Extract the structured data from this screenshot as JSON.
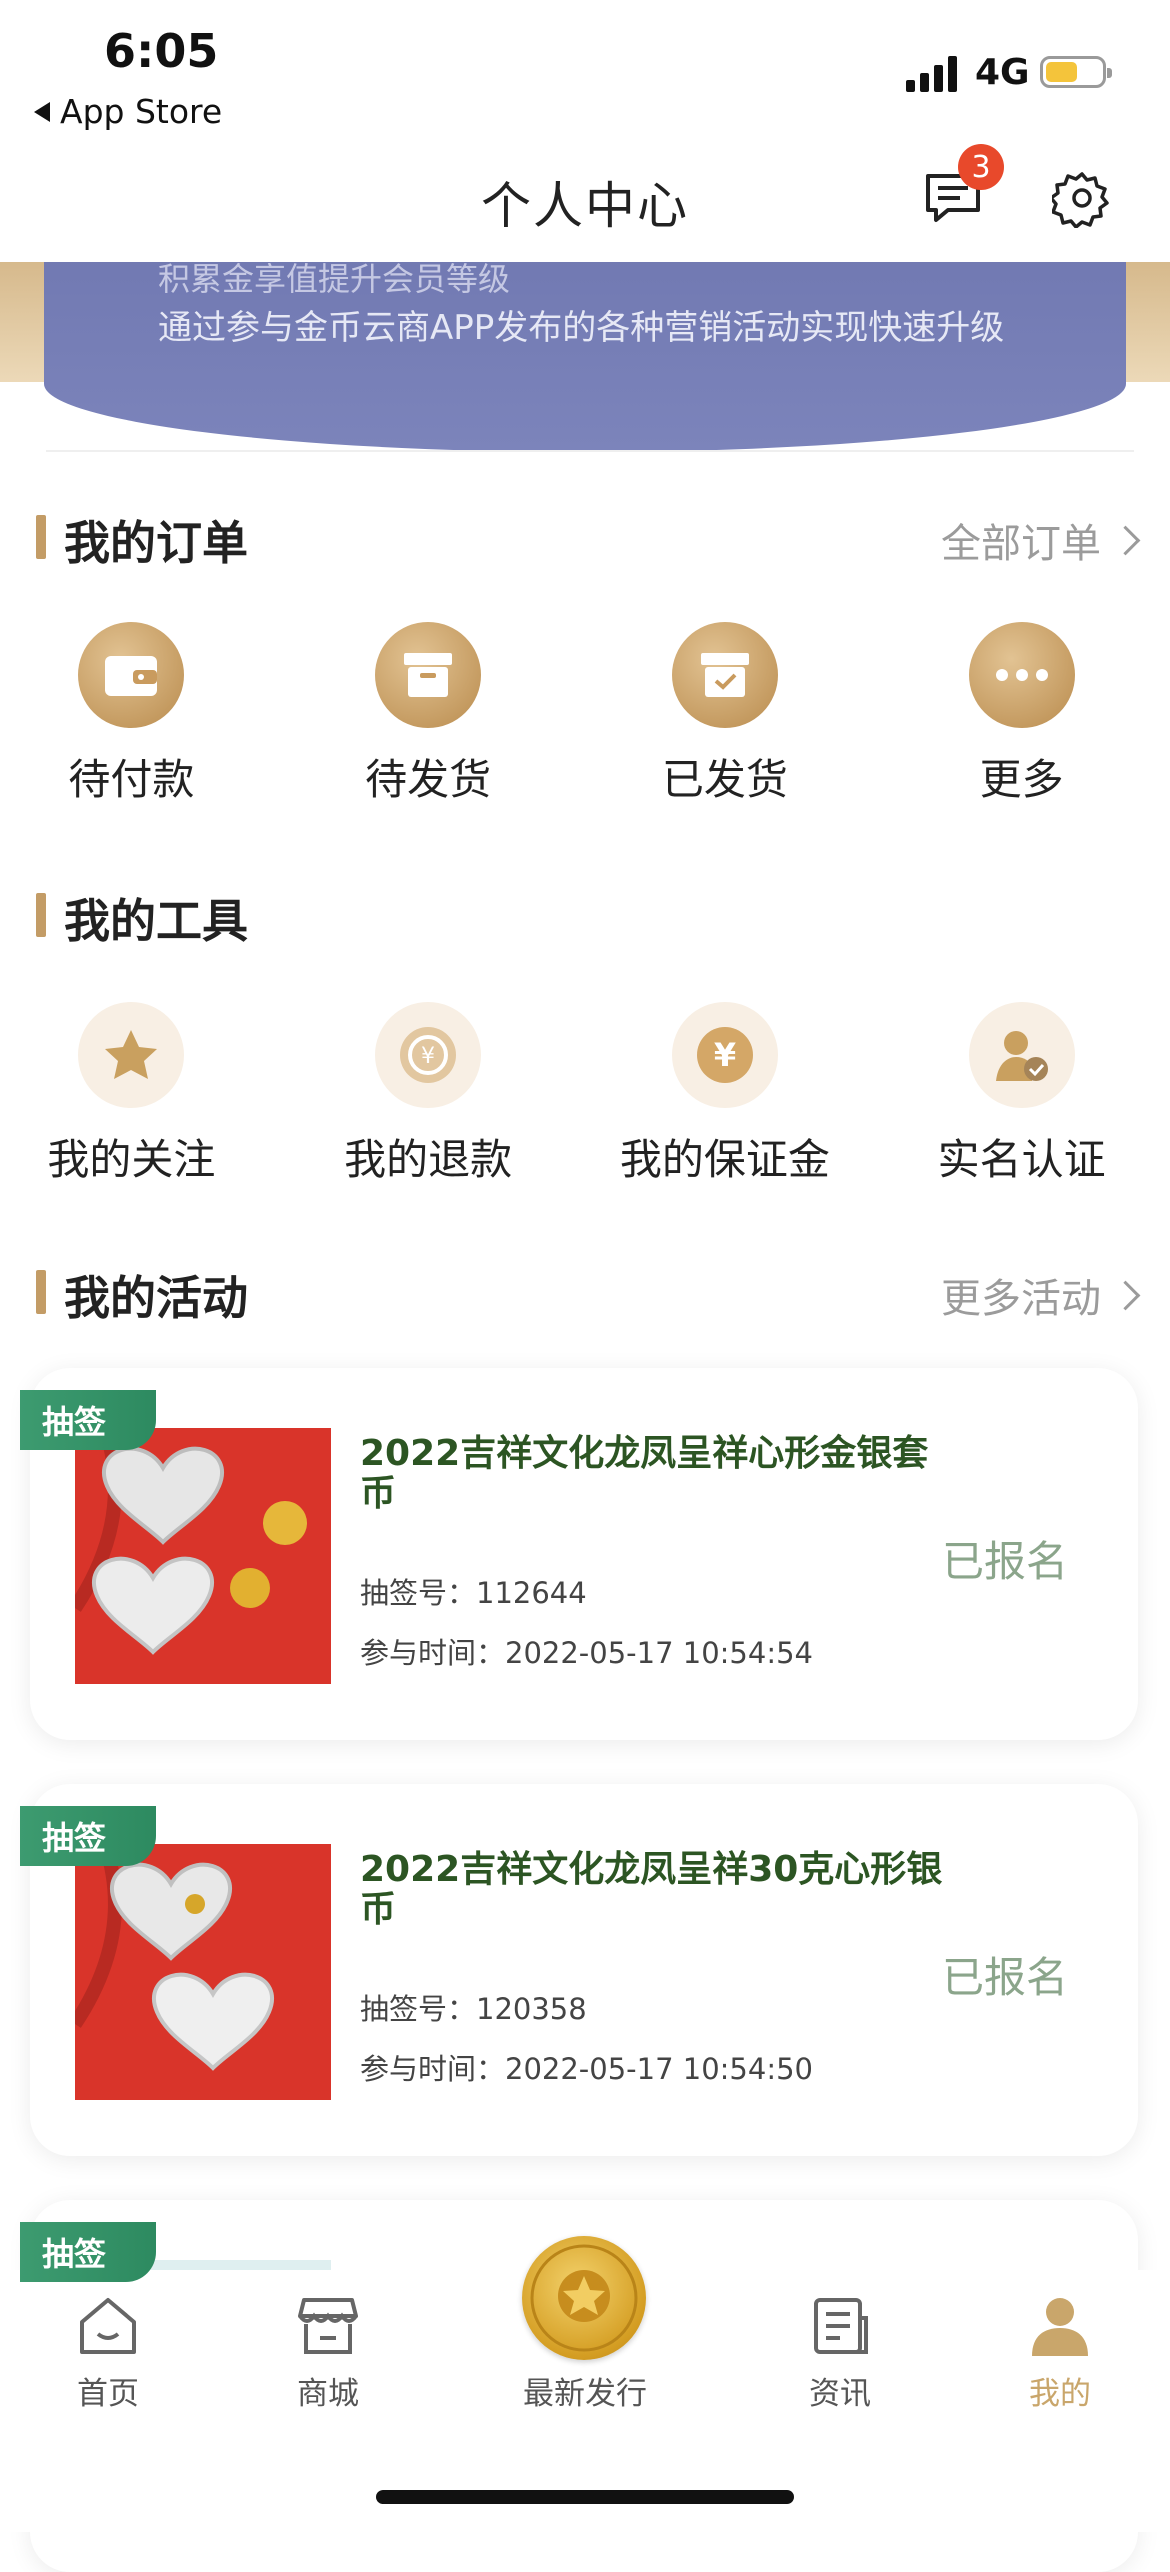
{
  "status_bar": {
    "time": "6:05",
    "back_label": "App Store",
    "network": "4G"
  },
  "nav": {
    "title": "个人中心",
    "message_badge": "3"
  },
  "banner": {
    "line1": "积累金享值提升会员等级",
    "line2": "通过参与金币云商APP发布的各种营销活动实现快速升级"
  },
  "orders": {
    "title": "我的订单",
    "more": "全部订单",
    "items": [
      {
        "label": "待付款",
        "icon": "wallet-icon"
      },
      {
        "label": "待发货",
        "icon": "box-icon"
      },
      {
        "label": "已发货",
        "icon": "shipped-box-icon"
      },
      {
        "label": "更多",
        "icon": "more-icon"
      }
    ]
  },
  "tools": {
    "title": "我的工具",
    "items": [
      {
        "label": "我的关注",
        "icon": "star-icon"
      },
      {
        "label": "我的退款",
        "icon": "refund-icon"
      },
      {
        "label": "我的保证金",
        "icon": "yen-icon"
      },
      {
        "label": "实名认证",
        "icon": "verified-user-icon"
      }
    ]
  },
  "activities": {
    "title": "我的活动",
    "more": "更多活动",
    "items": [
      {
        "tag": "抽签",
        "title": "2022吉祥文化龙凤呈祥心形金银套币",
        "number": "抽签号：112644",
        "time": "参与时间：2022-05-17 10:54:54",
        "status": "已报名"
      },
      {
        "tag": "抽签",
        "title": "2022吉祥文化龙凤呈祥30克心形银币",
        "number": "抽签号：120358",
        "time": "参与时间：2022-05-17 10:54:50",
        "status": "已报名"
      },
      {
        "tag": "抽签"
      }
    ]
  },
  "tabbar": {
    "items": [
      {
        "label": "首页",
        "icon": "home-icon"
      },
      {
        "label": "商城",
        "icon": "store-icon"
      },
      {
        "label": "最新发行",
        "icon": "coin-icon"
      },
      {
        "label": "资讯",
        "icon": "news-icon"
      },
      {
        "label": "我的",
        "icon": "profile-icon",
        "active": true
      }
    ]
  },
  "colors": {
    "accent_gold": "#c39c66",
    "tag_green": "#3d9b70",
    "title_green": "#2c5523",
    "status_green": "#8ba58b",
    "badge_red": "#e8492b"
  }
}
